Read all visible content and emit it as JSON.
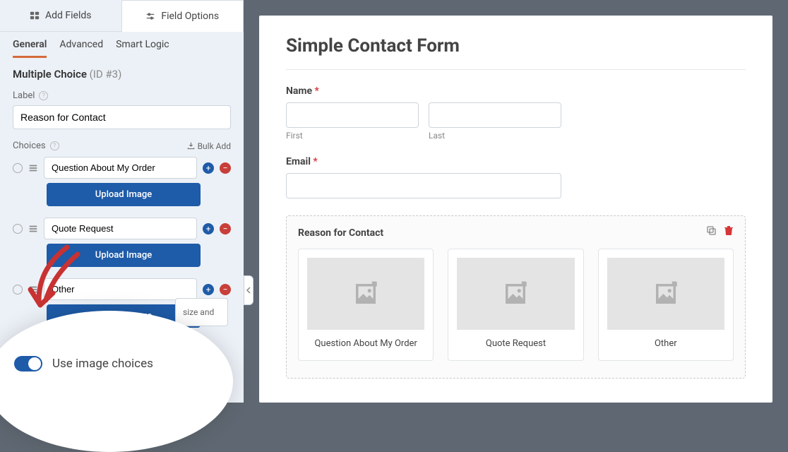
{
  "sidebar": {
    "tabs": {
      "add_fields": "Add Fields",
      "field_options": "Field Options"
    },
    "sub_tabs": {
      "general": "General",
      "advanced": "Advanced",
      "smart_logic": "Smart Logic"
    },
    "field_type": "Multiple Choice",
    "field_id": "(ID #3)",
    "label_label": "Label",
    "label_value": "Reason for Contact",
    "choices_label": "Choices",
    "bulk_add": "Bulk Add",
    "choices": [
      {
        "value": "Question About My Order",
        "upload_label": "Upload Image"
      },
      {
        "value": "Quote Request",
        "upload_label": "Upload Image"
      },
      {
        "value": "Other",
        "upload_label": "Upload Image"
      }
    ],
    "hint_fragment": "size and",
    "toggle_label": "Use image choices"
  },
  "form": {
    "title": "Simple Contact Form",
    "name_label": "Name",
    "first_sub": "First",
    "last_sub": "Last",
    "email_label": "Email",
    "reason_label": "Reason for Contact",
    "image_choices": [
      "Question About My Order",
      "Quote Request",
      "Other"
    ]
  }
}
